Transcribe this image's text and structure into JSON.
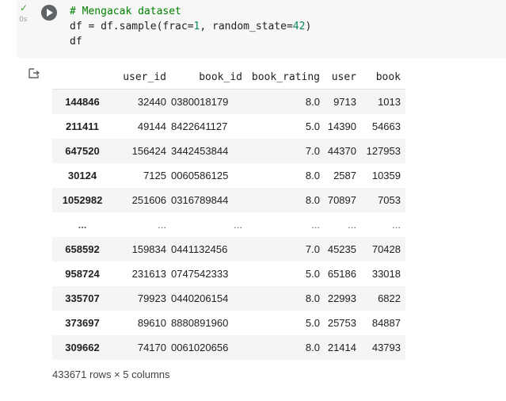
{
  "cell": {
    "status_icon": "check-icon",
    "exec_time": "0s",
    "run_icon": "play-icon",
    "code_lines": [
      {
        "prefix": "",
        "text": "# Mengacak dataset",
        "kind": "comment"
      },
      {
        "text": "df = df.sample(frac=1, random_state=42)",
        "kind": "code"
      },
      {
        "text": "df",
        "kind": "code"
      }
    ],
    "code": {
      "line1": "# Mengacak dataset",
      "line2_a": "df = df.sample(frac=",
      "line2_frac": "1",
      "line2_b": ", random_state=",
      "line2_seed": "42",
      "line2_c": ")",
      "line3": "df"
    }
  },
  "output": {
    "icon": "output-redirect-icon",
    "columns": [
      "",
      "user_id",
      "book_id",
      "book_rating",
      "user",
      "book"
    ],
    "rows": [
      [
        "144846",
        "32440",
        "0380018179",
        "8.0",
        "9713",
        "1013"
      ],
      [
        "211411",
        "49144",
        "8422641127",
        "5.0",
        "14390",
        "54663"
      ],
      [
        "647520",
        "156424",
        "3442453844",
        "7.0",
        "44370",
        "127953"
      ],
      [
        "30124",
        "7125",
        "0060586125",
        "8.0",
        "2587",
        "10359"
      ],
      [
        "1052982",
        "251606",
        "0316789844",
        "8.0",
        "70897",
        "7053"
      ],
      [
        "...",
        "...",
        "...",
        "...",
        "...",
        "..."
      ],
      [
        "658592",
        "159834",
        "0441132456",
        "7.0",
        "45235",
        "70428"
      ],
      [
        "958724",
        "231613",
        "0747542333",
        "5.0",
        "65186",
        "33018"
      ],
      [
        "335707",
        "79923",
        "0440206154",
        "8.0",
        "22993",
        "6822"
      ],
      [
        "373697",
        "89610",
        "8880891960",
        "5.0",
        "25753",
        "84887"
      ],
      [
        "309662",
        "74170",
        "0061020656",
        "8.0",
        "21414",
        "43793"
      ]
    ],
    "shape": "433671 rows × 5 columns"
  }
}
